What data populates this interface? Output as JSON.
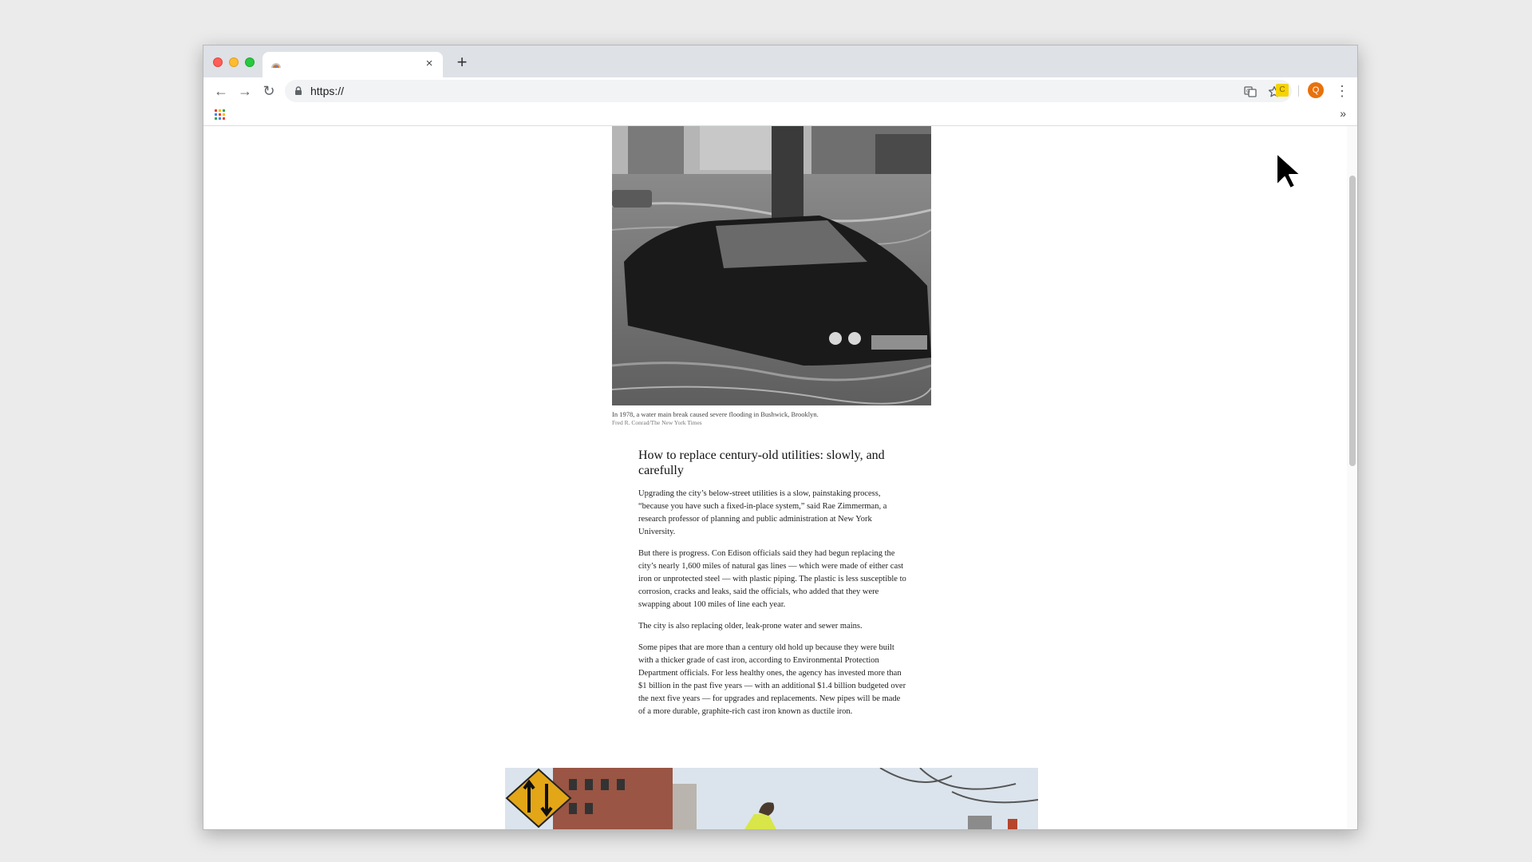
{
  "browser": {
    "tab": {
      "title": "",
      "close_glyph": "×"
    },
    "new_tab_glyph": "+",
    "nav": {
      "back_glyph": "←",
      "forward_glyph": "→",
      "reload_glyph": "↻"
    },
    "address_bar": {
      "url": "https://"
    },
    "extension_label": "C",
    "avatar_initial": "Q",
    "menu_glyph": "⋮",
    "bookmarks_more": "»"
  },
  "article": {
    "photo_caption": "In 1978, a water main break caused severe flooding in Bushwick, Brooklyn.",
    "photo_credit": "Fred R. Conrad/The New York Times",
    "headline": "How to replace century-old utilities: slowly, and carefully",
    "paragraphs": [
      "Upgrading the city’s below-street utilities is a slow, painstaking process, “because you have such a fixed-in-place system,” said Rae Zimmerman, a research professor of planning and public administration at New York University.",
      "But there is progress. Con Edison officials said they had begun replacing the city’s nearly 1,600 miles of natural gas lines — which were made of either cast iron or unprotected steel — with plastic piping. The plastic is less susceptible to corrosion, cracks and leaks, said the officials, who added that they were swapping about 100 miles of line each year.",
      "The city is also replacing older, leak-prone water and sewer mains.",
      "Some pipes that are more than a century old hold up because they were built with a thicker grade of cast iron, according to Environmental Protection Department officials. For less healthy ones, the agency has invested more than $1 billion in the past five years — with an additional $1.4 billion budgeted over the next five years — for upgrades and replacements. New pipes will be made of a more durable, graphite-rich cast iron known as ductile iron."
    ]
  },
  "colors": {
    "tabstrip": "#dee1e6",
    "omnibox": "#f1f3f4",
    "avatar": "#e8710a",
    "extension": "#f6d300"
  },
  "icons": [
    "tab-favicon-icon",
    "close-icon",
    "plus-icon",
    "back-arrow-icon",
    "forward-arrow-icon",
    "reload-icon",
    "lock-icon",
    "translate-icon",
    "star-icon",
    "extension-icon",
    "kebab-menu-icon",
    "apps-grid-icon",
    "chevron-double-right-icon",
    "mouse-cursor-icon"
  ]
}
